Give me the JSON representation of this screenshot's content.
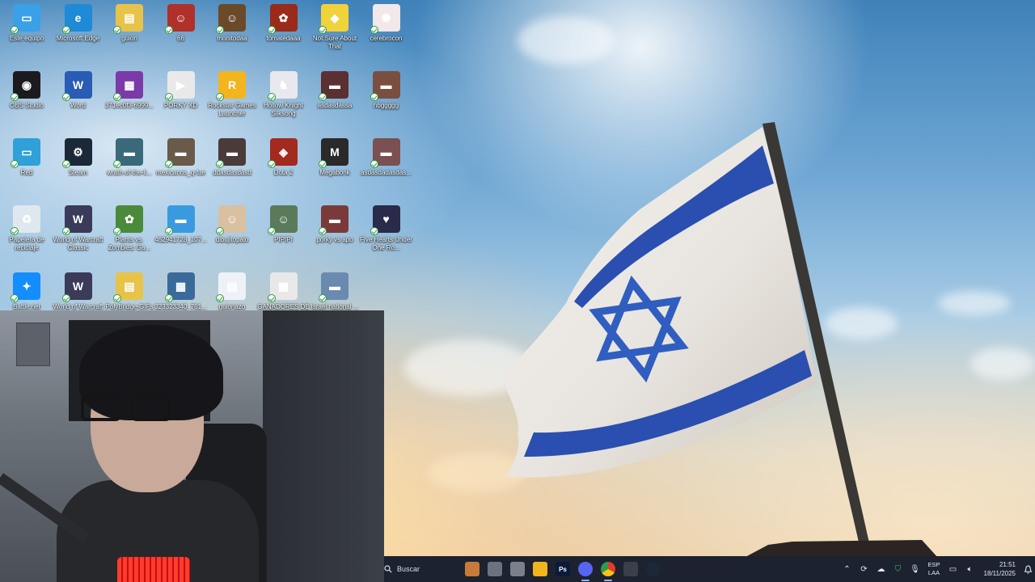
{
  "desktop": {
    "icons": [
      {
        "label": "Este equipo",
        "color": "#3aa0e8",
        "glyph": "▭"
      },
      {
        "label": "Microsoft Edge",
        "color": "#1f8ad6",
        "glyph": "e"
      },
      {
        "label": "guion",
        "color": "#e8c34a",
        "glyph": "▤"
      },
      {
        "label": "66",
        "color": "#b0302a",
        "glyph": "☺"
      },
      {
        "label": "monitodaa",
        "color": "#6b4a2a",
        "glyph": "☺"
      },
      {
        "label": "tomatedaaa",
        "color": "#9a2a1a",
        "glyph": "✿"
      },
      {
        "label": "Not Sure About That",
        "color": "#f0d23a",
        "glyph": "◆"
      },
      {
        "label": "cerebrocon",
        "color": "#f2e8ea",
        "glyph": "✺"
      },
      {
        "label": "OBS Studio",
        "color": "#1b1b1f",
        "glyph": "◉"
      },
      {
        "label": "Word",
        "color": "#2a5bb5",
        "glyph": "W"
      },
      {
        "label": "371ec0f3-6999...",
        "color": "#7a3aa8",
        "glyph": "▦"
      },
      {
        "label": "PORKY XD",
        "color": "#e9e9ea",
        "glyph": "▶"
      },
      {
        "label": "Rockstar Games Launcher",
        "color": "#f2b51e",
        "glyph": "R"
      },
      {
        "label": "Hollow Knight Silksong",
        "color": "#e8e8ee",
        "glyph": "♞"
      },
      {
        "label": "asdasdassa",
        "color": "#5a3030",
        "glyph": "▬"
      },
      {
        "label": "nbggggg",
        "color": "#7a4f40",
        "glyph": "▬"
      },
      {
        "label": "Red",
        "color": "#2fa0d8",
        "glyph": "▭"
      },
      {
        "label": "Steam",
        "color": "#1b2838",
        "glyph": "⚙"
      },
      {
        "label": "wrath-of-the-li...",
        "color": "#3a6a7a",
        "glyph": "▬"
      },
      {
        "label": "mexicanos_q-fue",
        "color": "#6a5a4a",
        "glyph": "▬"
      },
      {
        "label": "ddasdasdasd",
        "color": "#4a3a3a",
        "glyph": "▬"
      },
      {
        "label": "Dota 2",
        "color": "#a32a1e",
        "glyph": "◈"
      },
      {
        "label": "Megabonk",
        "color": "#2a2a2a",
        "glyph": "M"
      },
      {
        "label": "asdasdadasdas...",
        "color": "#7a5050",
        "glyph": "▬"
      },
      {
        "label": "Papelera de reciclaje",
        "color": "#dfe8ee",
        "glyph": "♻"
      },
      {
        "label": "World of Warcraft Classic",
        "color": "#3a3a5a",
        "glyph": "W"
      },
      {
        "label": "Plants vs. Zombies: Ga...",
        "color": "#4a8a3a",
        "glyph": "✿"
      },
      {
        "label": "462941728_107...",
        "color": "#3a9ae0",
        "glyph": "▬"
      },
      {
        "label": "dibujitopalo",
        "color": "#d8c0a0",
        "glyph": "☺"
      },
      {
        "label": "PIPIPI",
        "color": "#5a7a5a",
        "glyph": "☺"
      },
      {
        "label": "porky vs apo",
        "color": "#7a3a3a",
        "glyph": "▬"
      },
      {
        "label": "Five Hearts Under One Ro...",
        "color": "#2a2a4a",
        "glyph": "♥"
      },
      {
        "label": "Battle.net",
        "color": "#148eff",
        "glyph": "✦"
      },
      {
        "label": "World of Warcraft",
        "color": "#3a3a5a",
        "glyph": "W"
      },
      {
        "label": "PolyBridge-GIFs",
        "color": "#e8c34a",
        "glyph": "▤"
      },
      {
        "label": "323323340_761...",
        "color": "#3a6a9a",
        "glyph": "▦"
      },
      {
        "label": "guionazo",
        "color": "#eef2f8",
        "glyph": "▤"
      },
      {
        "label": "GANADORES DE LOS JUEGO...",
        "color": "#e8e8e8",
        "glyph": "▦"
      },
      {
        "label": "Israel national ...",
        "color": "#6a8ab0",
        "glyph": "▬"
      }
    ]
  },
  "taskbar": {
    "search_placeholder": "Buscar",
    "apps": [
      {
        "name": "taskbar-news-widget",
        "color": "#c77b3a",
        "label": ""
      },
      {
        "name": "taskbar-task-view",
        "color": "#6c7280",
        "label": ""
      },
      {
        "name": "taskbar-app-generic",
        "color": "#7a7f8a",
        "label": ""
      },
      {
        "name": "taskbar-file-explorer",
        "color": "#f2b51e",
        "label": ""
      },
      {
        "name": "taskbar-photoshop",
        "color": "#0a1a3a",
        "label": "Ps"
      },
      {
        "name": "taskbar-discord",
        "color": "#5865f2",
        "label": ""
      },
      {
        "name": "taskbar-chrome",
        "color": "#2f9a4a",
        "label": ""
      },
      {
        "name": "taskbar-app-record",
        "color": "#3a3f4a",
        "label": ""
      },
      {
        "name": "taskbar-steam",
        "color": "#1b2838",
        "label": ""
      }
    ],
    "lang_top": "ESP",
    "lang_bottom": "LAA",
    "time": "21:51",
    "date": "18/11/2025"
  }
}
